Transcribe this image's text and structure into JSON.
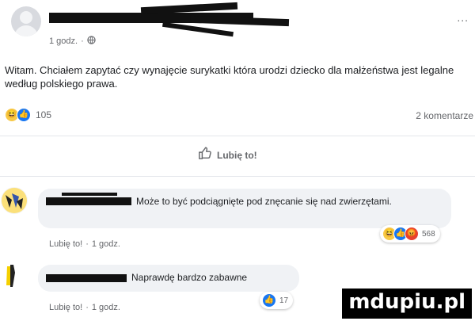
{
  "post": {
    "time": "1 godz.",
    "text": "Witam. Chciałem zapytać czy wynajęcie surykatki która urodzi dziecko dla małżeństwa jest legalne według polskiego prawa.",
    "reaction_count": "105",
    "comments_count": "2 komentarze",
    "more_label": "...",
    "like_action": "Lubię to!"
  },
  "comments": [
    {
      "text": "Może to być podciągnięte pod znęcanie się nad zwierzętami.",
      "like_label": "Lubię to!",
      "time": "1 godz.",
      "reaction_count": "568"
    },
    {
      "text": "Naprawdę bardzo zabawne",
      "like_label": "Lubię to!",
      "time": "1 godz.",
      "reaction_count": "17"
    }
  ],
  "watermark": "mdupiu.pl",
  "colors": {
    "like_blue": "#1877f2",
    "haha_yellow": "#f7c948",
    "angry_red": "#e7412f",
    "bubble": "#f0f2f5"
  },
  "icons": [
    "user-avatar-icon",
    "globe-icon",
    "haha-emoji-icon",
    "like-emoji-icon",
    "angry-emoji-icon",
    "thumbs-up-outline-icon"
  ]
}
